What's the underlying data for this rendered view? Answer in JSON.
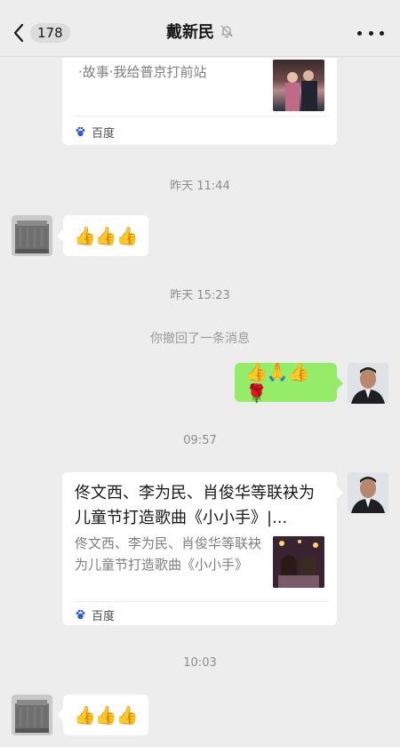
{
  "header": {
    "unread_count": "178",
    "title": "戴新民",
    "back_icon": "chevron-left-icon",
    "mute_icon": "bell-muted-icon",
    "more_icon": "more-dots-icon"
  },
  "messages": {
    "card1": {
      "desc": "·故事·我给普京打前站",
      "source": "百度"
    },
    "time1": "昨天 11:44",
    "emoji1": "👍👍👍",
    "time2": "昨天 15:23",
    "recall": "你撤回了一条消息",
    "emoji_me": "👍🙏👍🌹",
    "time3": "09:57",
    "card2": {
      "title": "佟文西、李为民、肖俊华等联袂为儿童节打造歌曲《小小手》|...",
      "desc": "佟文西、李为民、肖俊华等联袂为儿童节打造歌曲《小小手》",
      "source": "百度"
    },
    "time4": "10:03",
    "emoji2": "👍👍👍"
  },
  "colors": {
    "background": "#ededed",
    "my_bubble": "#95ec69",
    "their_bubble": "#ffffff"
  }
}
